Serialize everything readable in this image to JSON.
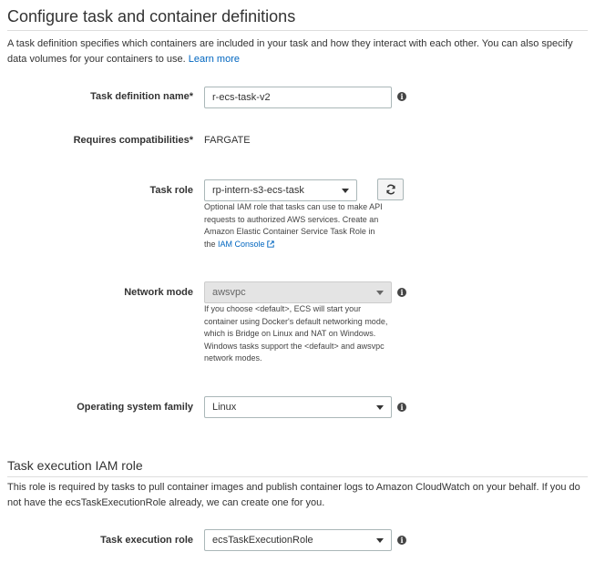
{
  "section1": {
    "title": "Configure task and container definitions",
    "description": "A task definition specifies which containers are included in your task and how they interact with each other. You can also specify data volumes for your containers to use.",
    "learn_more": "Learn more"
  },
  "fields": {
    "task_def_name": {
      "label": "Task definition name*",
      "value": "r-ecs-task-v2"
    },
    "compat": {
      "label": "Requires compatibilities*",
      "value": "FARGATE"
    },
    "task_role": {
      "label": "Task role",
      "value": "rp-intern-s3-ecs-task",
      "help": "Optional IAM role that tasks can use to make API requests to authorized AWS services. Create an Amazon Elastic Container Service Task Role in the",
      "help_link": "IAM Console"
    },
    "network_mode": {
      "label": "Network mode",
      "value": "awsvpc",
      "help": "If you choose <default>, ECS will start your container using Docker's default networking mode, which is Bridge on Linux and NAT on Windows. Windows tasks support the <default> and awsvpc network modes."
    },
    "os_family": {
      "label": "Operating system family",
      "value": "Linux"
    }
  },
  "section2": {
    "title": "Task execution IAM role",
    "description": "This role is required by tasks to pull container images and publish container logs to Amazon CloudWatch on your behalf. If you do not have the ecsTaskExecutionRole already, we can create one for you."
  },
  "exec_role": {
    "label": "Task execution role",
    "value": "ecsTaskExecutionRole"
  },
  "icons": {
    "info": "info-icon",
    "refresh": "refresh-icon",
    "external": "external-link-icon",
    "dropdown": "chevron-down-icon"
  },
  "colors": {
    "link": "#0066c0",
    "border": "#aab7b8",
    "disabled_bg": "#e4e4e4"
  }
}
